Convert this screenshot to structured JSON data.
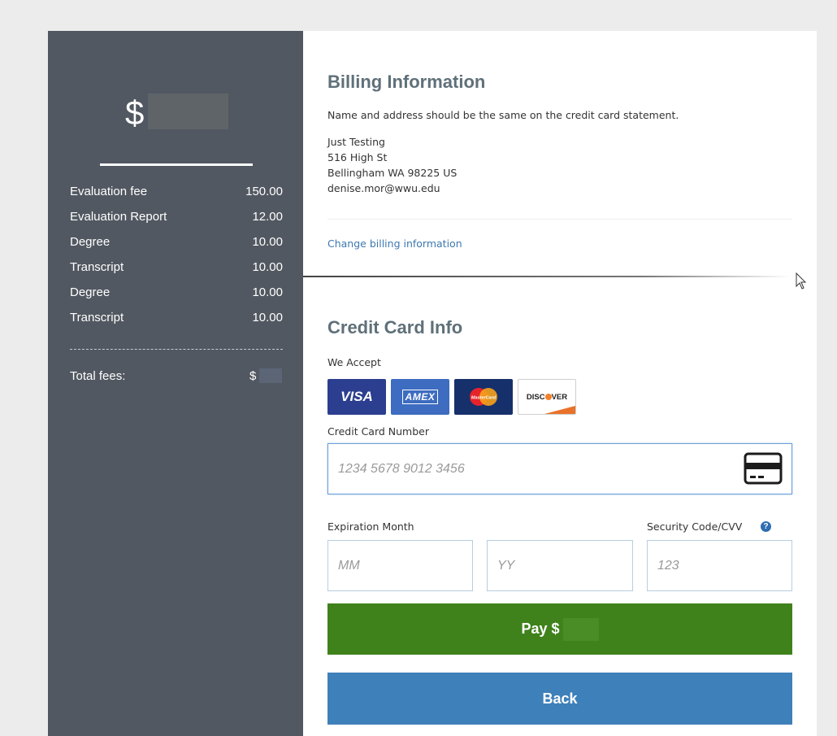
{
  "summary": {
    "currency_symbol": "$",
    "fees": [
      {
        "label": "Evaluation fee",
        "amount": "150.00"
      },
      {
        "label": "Evaluation Report",
        "amount": "12.00"
      },
      {
        "label": "Degree",
        "amount": "10.00"
      },
      {
        "label": "Transcript",
        "amount": "10.00"
      },
      {
        "label": "Degree",
        "amount": "10.00"
      },
      {
        "label": "Transcript",
        "amount": "10.00"
      }
    ],
    "total_label": "Total fees:",
    "total_currency": "$"
  },
  "billing": {
    "heading": "Billing Information",
    "note": "Name and address should be the same on the credit card statement.",
    "name": "Just Testing",
    "street": "516 High St",
    "city_line": "Bellingham WA 98225 US",
    "email": "denise.mor@wwu.edu",
    "change_link": "Change billing information"
  },
  "credit_card": {
    "heading": "Credit Card Info",
    "we_accept": "We Accept",
    "brands": {
      "visa": "VISA",
      "amex": "AMEX",
      "mastercard": "MasterCard",
      "discover_a": "DISC",
      "discover_b": "VER"
    },
    "number_label": "Credit Card Number",
    "number_placeholder": "1234 5678 9012 3456",
    "expiration_label": "Expiration Month",
    "month_placeholder": "MM",
    "year_placeholder": "YY",
    "cvv_label": "Security Code/CVV",
    "cvv_placeholder": "123",
    "help_glyph": "?"
  },
  "actions": {
    "pay_label": "Pay $",
    "back_label": "Back"
  },
  "colors": {
    "panel": "#525861",
    "heading": "#5f7079",
    "link": "#3d78b0",
    "pay": "#3f821c",
    "back": "#3e80b9"
  }
}
